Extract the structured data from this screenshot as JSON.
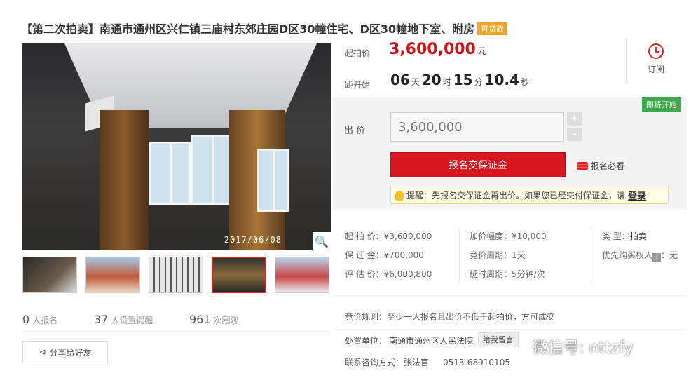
{
  "title": {
    "text": "【第二次拍卖】南通市通州区兴仁镇三庙村东郊庄园D区30幢住宅、D区30幢地下室、附房",
    "badge": "可贷款"
  },
  "gallery": {
    "date_stamp": "2017/06/08",
    "zoom_icon": "magnifier-icon",
    "thumbnail_count": 5,
    "active_thumbnail": 4
  },
  "stats": [
    {
      "num": "0",
      "label": "人报名"
    },
    {
      "num": "37",
      "label": "人设置提醒"
    },
    {
      "num": "961",
      "label": "次围观"
    }
  ],
  "share": {
    "label": "分享给好友",
    "icon": "share-icon"
  },
  "price": {
    "label": "起拍价",
    "value": "3,600,000",
    "unit": "元"
  },
  "countdown": {
    "label": "距开始",
    "days": "06",
    "days_unit": "天",
    "hours": "20",
    "hours_unit": "时",
    "minutes": "15",
    "minutes_unit": "分",
    "seconds": "10.4",
    "seconds_unit": "秒"
  },
  "subscribe": {
    "label": "订阅",
    "icon": "alarm-clock-icon"
  },
  "bid": {
    "status_tag": "即将开始",
    "label": "出 价",
    "input_value": "3,600,000",
    "plus": "+",
    "minus": "-",
    "deposit_button": "报名交保证金",
    "must_know": "报名必看",
    "tip_prefix": "提醒：先报名交保证金再出价。如果您已经交付保证金，请",
    "tip_link": "登录"
  },
  "info": {
    "start_price": "起 拍 价：¥3,600,000",
    "deposit": "保 证 金：¥700,000",
    "appraisal": "评 估 价：¥6,000,800",
    "increment": "加价幅度：¥10,000",
    "period": "竞价周期：1天",
    "extension": "延时周期：5分钟/次",
    "type_label": "类      型：",
    "type_value": "拍卖",
    "priority_label": "优先购买权人",
    "priority_icon": "?",
    "priority_value": "：无"
  },
  "rule": "竞价规则：至少一人报名且出价不低于起拍价，方可成交",
  "court": {
    "label": "处置单位：",
    "name": "南通市通州区人民法院",
    "message_button": "给我留言"
  },
  "contact": {
    "label": "联系咨询方式：张法官",
    "phone": "0513-68910105"
  },
  "watermark": "微信号: nttzfy"
}
